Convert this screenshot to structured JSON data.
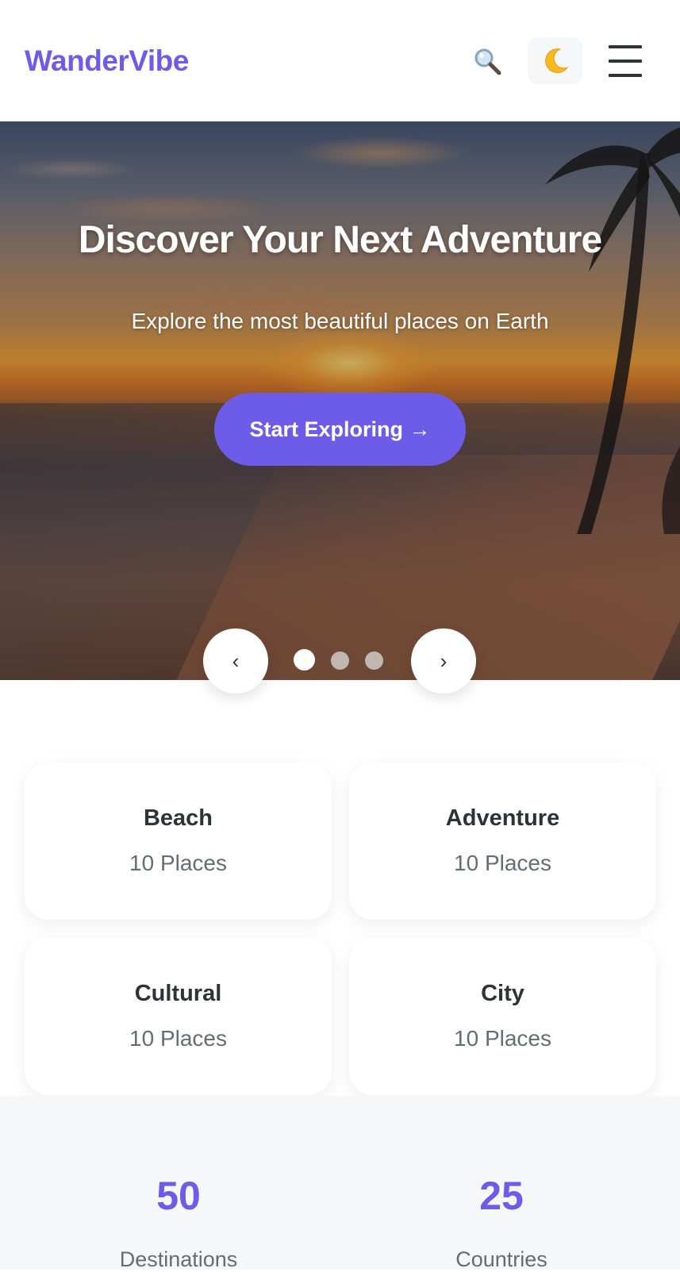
{
  "header": {
    "logo": "WanderVibe",
    "search_icon": "search-icon",
    "theme_icon": "moon-icon",
    "menu_icon": "hamburger-menu-icon"
  },
  "hero": {
    "title": "Discover Your Next Adventure",
    "subtitle": "Explore the most beautiful places on Earth",
    "cta_label": "Start Exploring →",
    "slide_count": 3,
    "active_slide": 1
  },
  "carousel": {
    "prev_label": "‹",
    "next_label": "›"
  },
  "categories": [
    {
      "name": "Beach",
      "count": "10 Places"
    },
    {
      "name": "Adventure",
      "count": "10 Places"
    },
    {
      "name": "Cultural",
      "count": "10 Places"
    },
    {
      "name": "City",
      "count": "10 Places"
    }
  ],
  "stats": [
    {
      "value": "50",
      "label": "Destinations"
    },
    {
      "value": "25",
      "label": "Countries"
    }
  ],
  "colors": {
    "accent": "#6c5ce7",
    "text": "#2d3436",
    "muted": "#636e72",
    "surface": "#f6f7f9"
  }
}
